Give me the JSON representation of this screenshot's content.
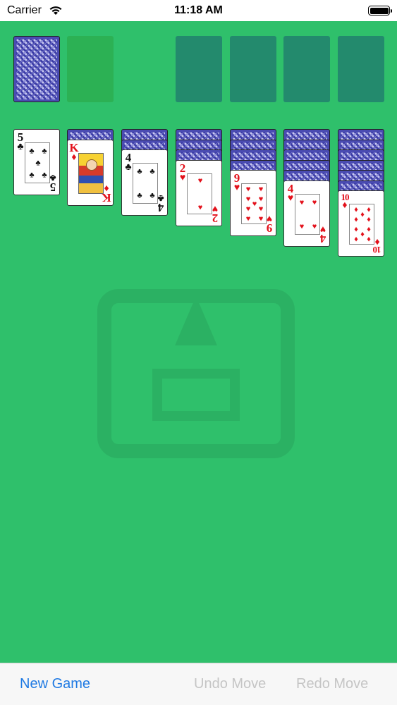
{
  "status_bar": {
    "carrier": "Carrier",
    "time": "11:18 AM",
    "battery_level": 1.0
  },
  "toolbar": {
    "new_game": "New Game",
    "undo": "Undo Move",
    "redo": "Redo Move",
    "active_color": "#1f7ae3",
    "disabled_color": "#c5c5c5"
  },
  "colors": {
    "table": "#2fc06b",
    "foundation_slot": "#238a6d",
    "waste_slot": "#2cb154",
    "card_back": "#4a4bb2",
    "red_suit": "#e3111b"
  },
  "stock": {
    "face_down": true
  },
  "tableau": [
    {
      "hidden": 0,
      "top": {
        "rank": "5",
        "suit": "♣",
        "color": "black"
      }
    },
    {
      "hidden": 1,
      "top": {
        "rank": "K",
        "suit": "♦",
        "color": "red"
      }
    },
    {
      "hidden": 2,
      "top": {
        "rank": "4",
        "suit": "♣",
        "color": "black"
      }
    },
    {
      "hidden": 3,
      "top": {
        "rank": "2",
        "suit": "♥",
        "color": "red"
      }
    },
    {
      "hidden": 4,
      "top": {
        "rank": "9",
        "suit": "♥",
        "color": "red"
      }
    },
    {
      "hidden": 5,
      "top": {
        "rank": "4",
        "suit": "♥",
        "color": "red"
      }
    },
    {
      "hidden": 6,
      "top": {
        "rank": "10",
        "suit": "♦",
        "color": "red"
      }
    }
  ]
}
